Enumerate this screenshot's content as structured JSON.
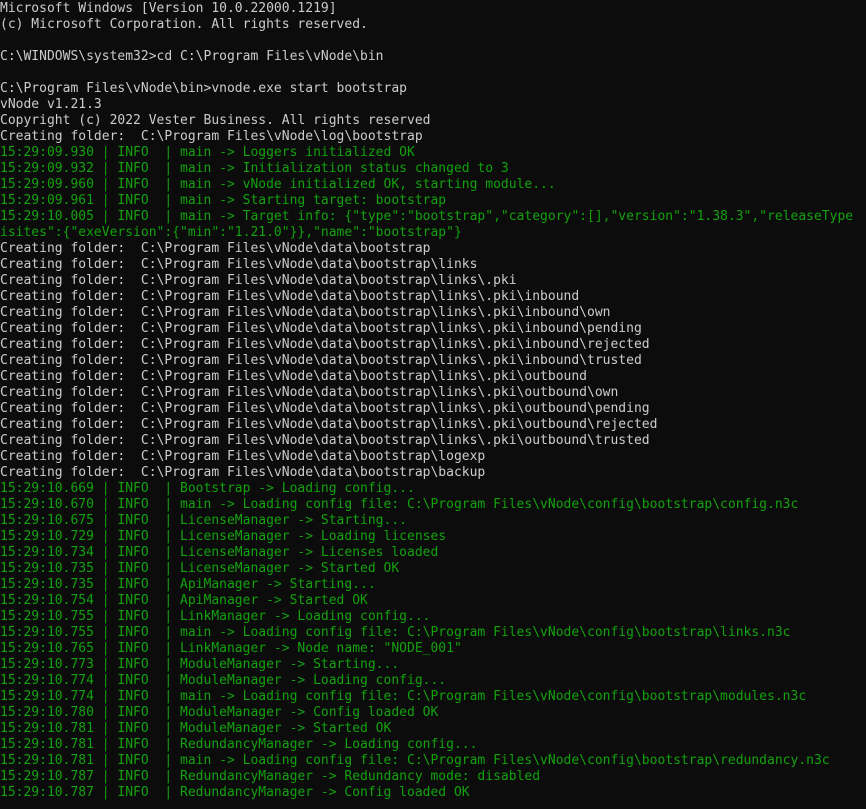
{
  "window": {
    "type": "Windows Command Prompt"
  },
  "colors": {
    "background": "#0c0c0c",
    "default_text": "#cccccc",
    "log_text": "#13a10e"
  },
  "console": {
    "lines": [
      {
        "text": "Microsoft Windows [Version 10.0.22000.1219]",
        "style": "plain"
      },
      {
        "text": "(c) Microsoft Corporation. All rights reserved.",
        "style": "plain"
      },
      {
        "text": "",
        "style": "plain"
      },
      {
        "text": "C:\\WINDOWS\\system32>cd C:\\Program Files\\vNode\\bin",
        "style": "plain"
      },
      {
        "text": "",
        "style": "plain"
      },
      {
        "text": "C:\\Program Files\\vNode\\bin>vnode.exe start bootstrap",
        "style": "plain"
      },
      {
        "text": "vNode v1.21.3",
        "style": "plain"
      },
      {
        "text": "Copyright (c) 2022 Vester Business. All rights reserved",
        "style": "plain"
      },
      {
        "text": "Creating folder:  C:\\Program Files\\vNode\\log\\bootstrap",
        "style": "plain"
      },
      {
        "text": "15:29:09.930 | INFO  | main -> Loggers initialized OK",
        "style": "log"
      },
      {
        "text": "15:29:09.932 | INFO  | main -> Initialization status changed to 3",
        "style": "log"
      },
      {
        "text": "15:29:09.960 | INFO  | main -> vNode initialized OK, starting module...",
        "style": "log"
      },
      {
        "text": "15:29:09.961 | INFO  | main -> Starting target: bootstrap",
        "style": "log"
      },
      {
        "text": "15:29:10.005 | INFO  | main -> Target info: {\"type\":\"bootstrap\",\"category\":[],\"version\":\"1.38.3\",\"releaseType",
        "style": "log"
      },
      {
        "text": "isites\":{\"exeVersion\":{\"min\":\"1.21.0\"}},\"name\":\"bootstrap\"}",
        "style": "log"
      },
      {
        "text": "Creating folder:  C:\\Program Files\\vNode\\data\\bootstrap",
        "style": "plain"
      },
      {
        "text": "Creating folder:  C:\\Program Files\\vNode\\data\\bootstrap\\links",
        "style": "plain"
      },
      {
        "text": "Creating folder:  C:\\Program Files\\vNode\\data\\bootstrap\\links\\.pki",
        "style": "plain"
      },
      {
        "text": "Creating folder:  C:\\Program Files\\vNode\\data\\bootstrap\\links\\.pki\\inbound",
        "style": "plain"
      },
      {
        "text": "Creating folder:  C:\\Program Files\\vNode\\data\\bootstrap\\links\\.pki\\inbound\\own",
        "style": "plain"
      },
      {
        "text": "Creating folder:  C:\\Program Files\\vNode\\data\\bootstrap\\links\\.pki\\inbound\\pending",
        "style": "plain"
      },
      {
        "text": "Creating folder:  C:\\Program Files\\vNode\\data\\bootstrap\\links\\.pki\\inbound\\rejected",
        "style": "plain"
      },
      {
        "text": "Creating folder:  C:\\Program Files\\vNode\\data\\bootstrap\\links\\.pki\\inbound\\trusted",
        "style": "plain"
      },
      {
        "text": "Creating folder:  C:\\Program Files\\vNode\\data\\bootstrap\\links\\.pki\\outbound",
        "style": "plain"
      },
      {
        "text": "Creating folder:  C:\\Program Files\\vNode\\data\\bootstrap\\links\\.pki\\outbound\\own",
        "style": "plain"
      },
      {
        "text": "Creating folder:  C:\\Program Files\\vNode\\data\\bootstrap\\links\\.pki\\outbound\\pending",
        "style": "plain"
      },
      {
        "text": "Creating folder:  C:\\Program Files\\vNode\\data\\bootstrap\\links\\.pki\\outbound\\rejected",
        "style": "plain"
      },
      {
        "text": "Creating folder:  C:\\Program Files\\vNode\\data\\bootstrap\\links\\.pki\\outbound\\trusted",
        "style": "plain"
      },
      {
        "text": "Creating folder:  C:\\Program Files\\vNode\\data\\bootstrap\\logexp",
        "style": "plain"
      },
      {
        "text": "Creating folder:  C:\\Program Files\\vNode\\data\\bootstrap\\backup",
        "style": "plain"
      },
      {
        "text": "15:29:10.669 | INFO  | Bootstrap -> Loading config...",
        "style": "log"
      },
      {
        "text": "15:29:10.670 | INFO  | main -> Loading config file: C:\\Program Files\\vNode\\config\\bootstrap\\config.n3c",
        "style": "log"
      },
      {
        "text": "15:29:10.675 | INFO  | LicenseManager -> Starting...",
        "style": "log"
      },
      {
        "text": "15:29:10.729 | INFO  | LicenseManager -> Loading licenses",
        "style": "log"
      },
      {
        "text": "15:29:10.734 | INFO  | LicenseManager -> Licenses loaded",
        "style": "log"
      },
      {
        "text": "15:29:10.735 | INFO  | LicenseManager -> Started OK",
        "style": "log"
      },
      {
        "text": "15:29:10.735 | INFO  | ApiManager -> Starting...",
        "style": "log"
      },
      {
        "text": "15:29:10.754 | INFO  | ApiManager -> Started OK",
        "style": "log"
      },
      {
        "text": "15:29:10.755 | INFO  | LinkManager -> Loading config...",
        "style": "log"
      },
      {
        "text": "15:29:10.755 | INFO  | main -> Loading config file: C:\\Program Files\\vNode\\config\\bootstrap\\links.n3c",
        "style": "log"
      },
      {
        "text": "15:29:10.765 | INFO  | LinkManager -> Node name: \"NODE_001\"",
        "style": "log"
      },
      {
        "text": "15:29:10.773 | INFO  | ModuleManager -> Starting...",
        "style": "log"
      },
      {
        "text": "15:29:10.774 | INFO  | ModuleManager -> Loading config...",
        "style": "log"
      },
      {
        "text": "15:29:10.774 | INFO  | main -> Loading config file: C:\\Program Files\\vNode\\config\\bootstrap\\modules.n3c",
        "style": "log"
      },
      {
        "text": "15:29:10.780 | INFO  | ModuleManager -> Config loaded OK",
        "style": "log"
      },
      {
        "text": "15:29:10.781 | INFO  | ModuleManager -> Started OK",
        "style": "log"
      },
      {
        "text": "15:29:10.781 | INFO  | RedundancyManager -> Loading config...",
        "style": "log"
      },
      {
        "text": "15:29:10.781 | INFO  | main -> Loading config file: C:\\Program Files\\vNode\\config\\bootstrap\\redundancy.n3c",
        "style": "log"
      },
      {
        "text": "15:29:10.787 | INFO  | RedundancyManager -> Redundancy mode: disabled",
        "style": "log"
      },
      {
        "text": "15:29:10.787 | INFO  | RedundancyManager -> Config loaded OK",
        "style": "log"
      }
    ]
  }
}
